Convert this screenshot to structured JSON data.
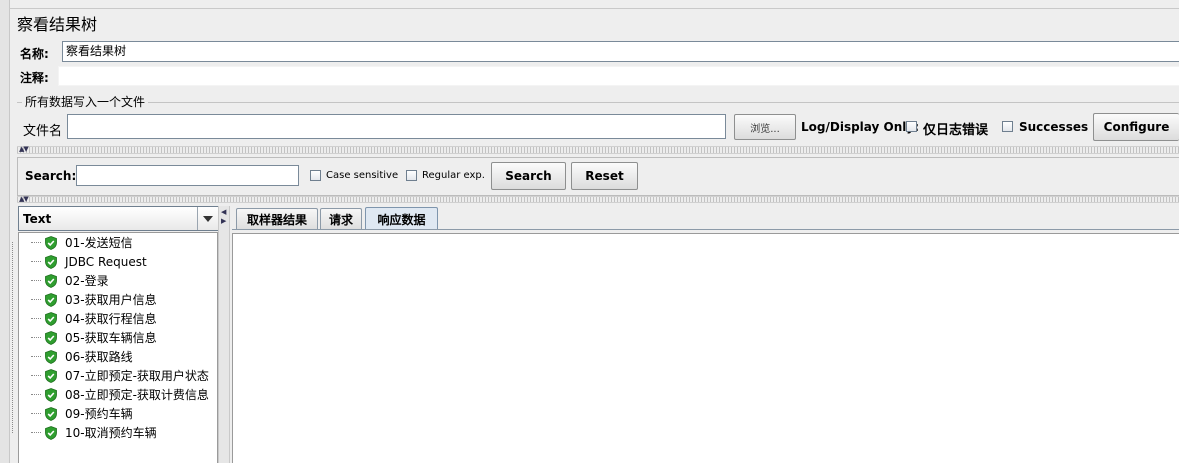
{
  "title": "察看结果树",
  "name_label": "名称:",
  "name_value": "察看结果树",
  "comment_label": "注释:",
  "comment_value": "",
  "file_group_title": "所有数据写入一个文件",
  "file_label": "文件名",
  "file_value": "",
  "browse_label": "浏览...",
  "log_display_label": "Log/Display Only:",
  "errors_label": "仅日志错误",
  "errors_checked": false,
  "successes_label": "Successes",
  "successes_checked": false,
  "configure_label": "Configure",
  "search": {
    "label": "Search:",
    "value": "",
    "case_sensitive_label": "Case sensitive",
    "case_sensitive_checked": false,
    "regex_label": "Regular exp.",
    "regex_checked": false,
    "search_button": "Search",
    "reset_button": "Reset"
  },
  "renderer": {
    "selected": "Text"
  },
  "tree_items": [
    {
      "label": "01-发送短信",
      "status": "success"
    },
    {
      "label": "JDBC Request",
      "status": "success"
    },
    {
      "label": "02-登录",
      "status": "success"
    },
    {
      "label": "03-获取用户信息",
      "status": "success"
    },
    {
      "label": "04-获取行程信息",
      "status": "success"
    },
    {
      "label": "05-获取车辆信息",
      "status": "success"
    },
    {
      "label": "06-获取路线",
      "status": "success"
    },
    {
      "label": "07-立即预定-获取用户状态",
      "status": "success"
    },
    {
      "label": "08-立即预定-获取计费信息",
      "status": "success"
    },
    {
      "label": "09-预约车辆",
      "status": "success"
    },
    {
      "label": "10-取消预约车辆",
      "status": "success"
    }
  ],
  "tabs": [
    {
      "label": "取样器结果",
      "active": false
    },
    {
      "label": "请求",
      "active": false
    },
    {
      "label": "响应数据",
      "active": true
    }
  ],
  "colors": {
    "success_green": "#2f9e2f",
    "active_tab": "#dfe8f2"
  },
  "icons": {
    "tree_item": "green-shield-check-icon",
    "combo": "chevron-down-icon",
    "splitter": "collapse-expand-arrows-icon"
  }
}
